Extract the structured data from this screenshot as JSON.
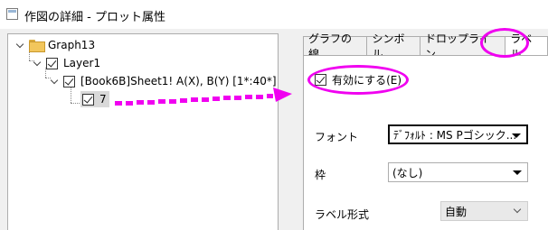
{
  "window": {
    "title": "作図の詳細 - プロット属性"
  },
  "tree": {
    "graph": "Graph13",
    "layer": "Layer1",
    "plot": "[Book6B]Sheet1! A(X), B(Y)  [1*:40*]",
    "subitem": "7"
  },
  "tabs": [
    {
      "label": "グラフの線"
    },
    {
      "label": "シンボル"
    },
    {
      "label": "ドロップライン"
    },
    {
      "label": "ラベル"
    }
  ],
  "label_tab": {
    "enable_label": "有効にする(E)",
    "font_label": "フォント",
    "font_value": "ﾃﾞﾌｫﾙﾄ : MS Pゴシック...",
    "frame_label": "枠",
    "frame_value": "(なし)",
    "format_label": "ラベル形式",
    "format_value": "自動"
  },
  "annotation_color": "#f000f0"
}
